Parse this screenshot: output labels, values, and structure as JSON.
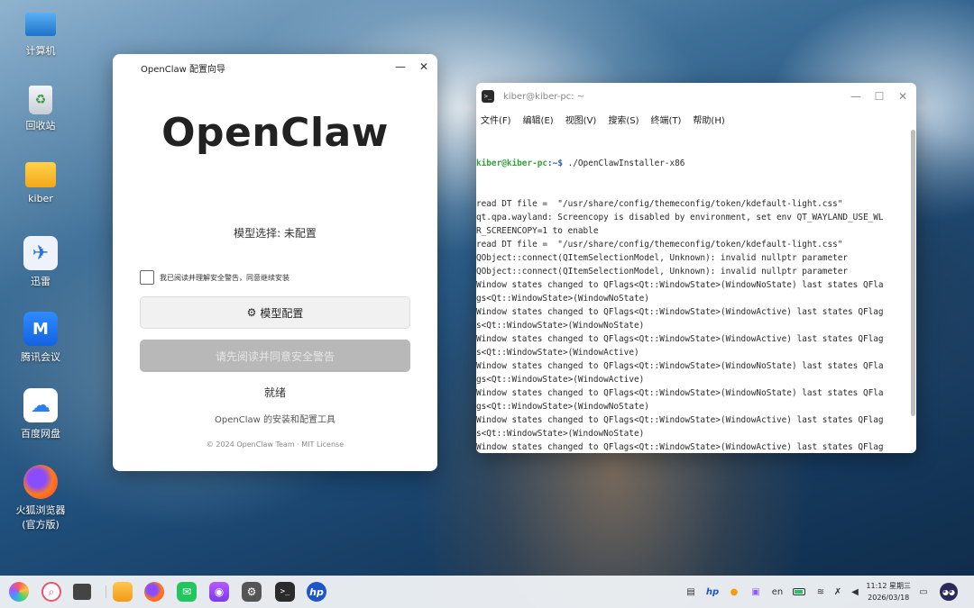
{
  "desktop": {
    "icons": [
      {
        "label": "计算机",
        "icon": "computer-icon"
      },
      {
        "label": "回收站",
        "icon": "trash-icon"
      },
      {
        "label": "kiber",
        "icon": "folder-icon"
      },
      {
        "label": "迅雷",
        "icon": "thunder-icon"
      },
      {
        "label": "腾讯会议",
        "icon": "tencent-meeting-icon"
      },
      {
        "label": "百度网盘",
        "icon": "baidu-netdisk-icon"
      },
      {
        "label": "火狐浏览器(官方版)",
        "icon": "firefox-icon"
      }
    ]
  },
  "installer": {
    "window_title": "OpenClaw 配置向导",
    "brand": "OpenClaw",
    "model_selection": "模型选择: 未配置",
    "agree_label": "我已阅读并理解安全警告，同意继续安装",
    "config_button": "模型配置",
    "config_icon": "⚙",
    "disabled_button": "请先阅读并同意安全警告",
    "status": "就绪",
    "description": "OpenClaw 的安装和配置工具",
    "footer": "© 2024 OpenClaw Team  ·  MIT License",
    "minimize_glyph": "—",
    "close_glyph": "✕"
  },
  "terminal": {
    "window_title": "kiber@kiber-pc: ~",
    "menu": [
      "文件(F)",
      "编辑(E)",
      "视图(V)",
      "搜索(S)",
      "终端(T)",
      "帮助(H)"
    ],
    "prompt_user": "kiber@kiber-pc",
    "prompt_path": ":~$",
    "command": " ./OpenClawInstaller-x86",
    "lines": [
      "read DT file =  \"/usr/share/config/themeconfig/token/kdefault-light.css\"",
      "qt.qpa.wayland: Screencopy is disabled by environment, set env QT_WAYLAND_USE_WL",
      "R_SCREENCOPY=1 to enable",
      "read DT file =  \"/usr/share/config/themeconfig/token/kdefault-light.css\"",
      "QObject::connect(QItemSelectionModel, Unknown): invalid nullptr parameter",
      "QObject::connect(QItemSelectionModel, Unknown): invalid nullptr parameter",
      "Window states changed to QFlags<Qt::WindowState>(WindowNoState) last states QFla",
      "gs<Qt::WindowState>(WindowNoState)",
      "Window states changed to QFlags<Qt::WindowState>(WindowActive) last states QFlag",
      "s<Qt::WindowState>(WindowNoState)",
      "Window states changed to QFlags<Qt::WindowState>(WindowActive) last states QFlag",
      "s<Qt::WindowState>(WindowActive)",
      "Window states changed to QFlags<Qt::WindowState>(WindowNoState) last states QFla",
      "gs<Qt::WindowState>(WindowActive)",
      "Window states changed to QFlags<Qt::WindowState>(WindowNoState) last states QFla",
      "gs<Qt::WindowState>(WindowNoState)",
      "Window states changed to QFlags<Qt::WindowState>(WindowActive) last states QFlag",
      "s<Qt::WindowState>(WindowNoState)",
      "Window states changed to QFlags<Qt::WindowState>(WindowActive) last states QFlag",
      "s<Qt::WindowState>(WindowActive)",
      "Window states changed to QFlags<Qt::WindowState>(WindowNoState) last states QFla",
      "gs<Qt::WindowState>(WindowActive)",
      "Window states changed to QFlags<Qt::WindowState>(WindowNoState) last states QFla"
    ],
    "minimize_glyph": "—",
    "maximize_glyph": "☐",
    "close_glyph": "✕"
  },
  "taskbar": {
    "apps": [
      "start-menu-icon",
      "search-icon",
      "multitask-view-icon",
      "file-manager-icon",
      "firefox-icon",
      "wechat-icon",
      "camera-icon",
      "settings-icon",
      "terminal-icon",
      "hp-icon"
    ],
    "tray": [
      "clipboard-icon",
      "hp-tray-icon",
      "sun-icon",
      "calendar-icon",
      "input-method-icon",
      "battery-icon",
      "wifi-icon",
      "bluetooth-off-icon",
      "volume-icon",
      "notification-icon",
      "assistant-icon"
    ],
    "input_method": "en",
    "hp_text": "hp",
    "clock_time": "11:12 星期三",
    "clock_date": "2026/03/18"
  }
}
